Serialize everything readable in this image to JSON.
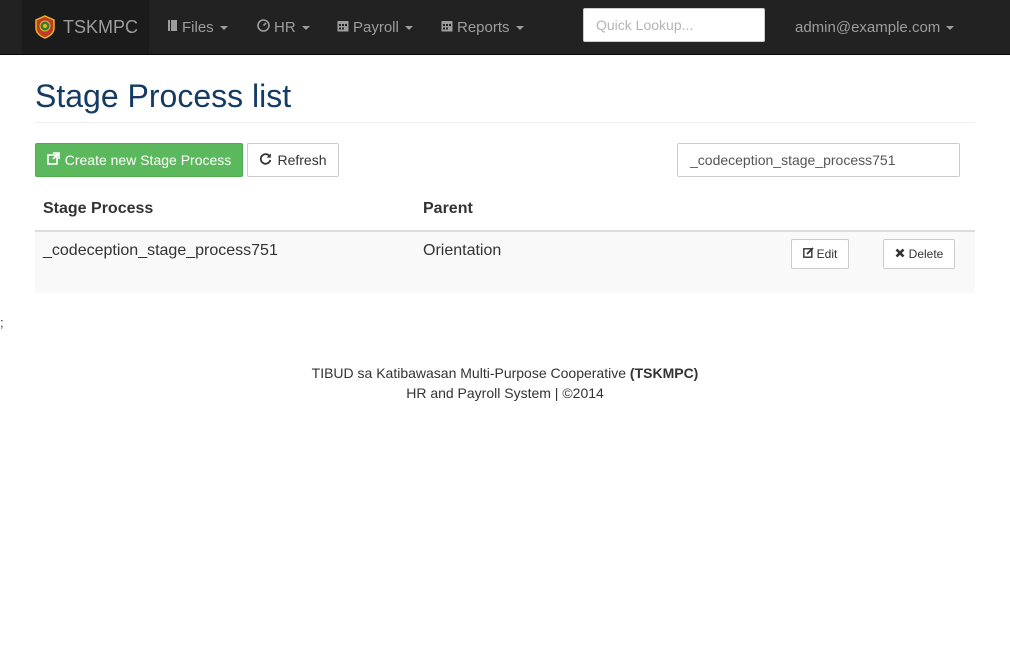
{
  "navbar": {
    "brand": "TSKMPC",
    "menu": [
      {
        "label": "Files",
        "icon": "file-icon"
      },
      {
        "label": "HR",
        "icon": "dashboard-icon"
      },
      {
        "label": "Payroll",
        "icon": "calendar-icon"
      },
      {
        "label": "Reports",
        "icon": "calendar-icon"
      }
    ],
    "search_placeholder": "Quick Lookup...",
    "user": "admin@example.com"
  },
  "page": {
    "title": "Stage Process list",
    "create_button": "Create new Stage Process",
    "refresh_button": "Refresh",
    "filter_value": "_codeception_stage_process751"
  },
  "table": {
    "columns": [
      "Stage Process",
      "Parent"
    ],
    "rows": [
      {
        "stage_process": "_codeception_stage_process751",
        "parent": "Orientation",
        "edit": "Edit",
        "delete": "Delete"
      }
    ]
  },
  "stray_text": ";",
  "footer": {
    "org": "TIBUD sa Katibawasan Multi-Purpose Cooperative",
    "abbr": "(TSKMPC)",
    "line2": "HR and Payroll System | ©2014"
  },
  "colors": {
    "navbar_bg": "#222222",
    "title": "#143b63",
    "success": "#5cb85c"
  }
}
